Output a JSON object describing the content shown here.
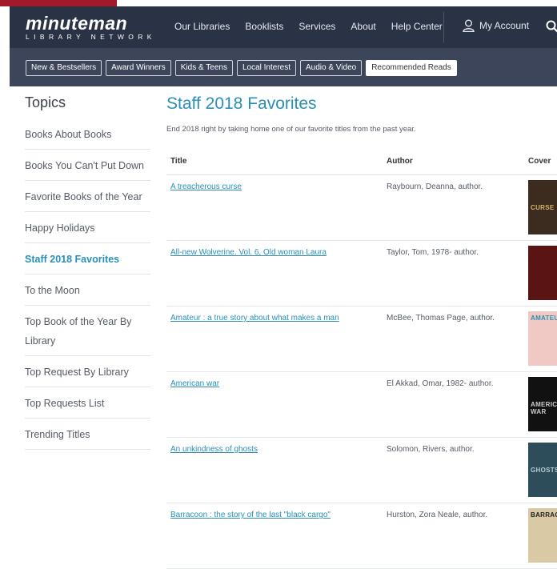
{
  "header": {
    "logo_main": "minuteman",
    "logo_sub": "LIBRARY NETWORK",
    "nav": [
      "Our Libraries",
      "Booklists",
      "Services",
      "About",
      "Help Center"
    ],
    "account": "My Account"
  },
  "subnav": [
    "New & Bestsellers",
    "Award Winners",
    "Kids & Teens",
    "Local Interest",
    "Audio & Video",
    "Recommended Reads"
  ],
  "subnav_active": "Recommended Reads",
  "sidebar": {
    "title": "Topics",
    "items": [
      "Books About Books",
      "Books You Can't Put Down",
      "Favorite Books of the Year",
      "Happy Holidays",
      "Staff 2018 Favorites",
      "To the Moon",
      "Top Book of the Year By Library",
      "Top Request By Library",
      "Top Requests List",
      "Trending Titles"
    ],
    "active": "Staff 2018 Favorites"
  },
  "main": {
    "title": "Staff 2018 Favorites",
    "intro": "End 2018 right by taking home one of our favorite titles from the past year.",
    "columns": [
      "Title",
      "Author",
      "Cover"
    ],
    "rows": [
      {
        "title": "A treacherous curse",
        "author": "Raybourn, Deanna, author.",
        "cover_text": "CURSE",
        "cover_color": "#3b2c1f",
        "cover_accent": "#d6b36a"
      },
      {
        "title": "All-new Wolverine. Vol. 6, Old woman Laura",
        "author": "Taylor, Tom, 1978- author.",
        "cover_text": "",
        "cover_color": "#5a1414",
        "cover_accent": "#c9cfd6"
      },
      {
        "title": "Amateur : a true story about what makes a man",
        "author": "McBee, Thomas Page, author.",
        "cover_text": "AMATEUR",
        "cover_color": "#f1c9c4",
        "cover_accent": "#2e8fb0"
      },
      {
        "title": "American war",
        "author": "El Akkad, Omar, 1982- author.",
        "cover_text": "AMERICAN WAR",
        "cover_color": "#111111",
        "cover_accent": "#cccccc"
      },
      {
        "title": "An unkindness of ghosts",
        "author": "Solomon, Rivers, author.",
        "cover_text": "GHOSTS",
        "cover_color": "#2d4d5a",
        "cover_accent": "#b8cdd3"
      },
      {
        "title": "Barracoon : the story of the last \"black cargo\"",
        "author": "Hurston, Zora Neale, author.",
        "cover_text": "BARRACOON",
        "cover_color": "#d9c9a5",
        "cover_accent": "#1e1e1e"
      }
    ]
  }
}
